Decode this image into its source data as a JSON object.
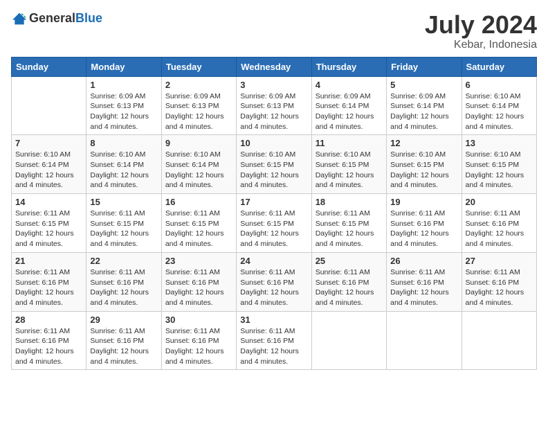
{
  "header": {
    "logo_general": "General",
    "logo_blue": "Blue",
    "month_title": "July 2024",
    "location": "Kebar, Indonesia"
  },
  "days_of_week": [
    "Sunday",
    "Monday",
    "Tuesday",
    "Wednesday",
    "Thursday",
    "Friday",
    "Saturday"
  ],
  "weeks": [
    [
      {
        "day": "",
        "sunrise": "",
        "sunset": "",
        "daylight": ""
      },
      {
        "day": "1",
        "sunrise": "6:09 AM",
        "sunset": "6:13 PM",
        "daylight": "12 hours and 4 minutes."
      },
      {
        "day": "2",
        "sunrise": "6:09 AM",
        "sunset": "6:13 PM",
        "daylight": "12 hours and 4 minutes."
      },
      {
        "day": "3",
        "sunrise": "6:09 AM",
        "sunset": "6:13 PM",
        "daylight": "12 hours and 4 minutes."
      },
      {
        "day": "4",
        "sunrise": "6:09 AM",
        "sunset": "6:14 PM",
        "daylight": "12 hours and 4 minutes."
      },
      {
        "day": "5",
        "sunrise": "6:09 AM",
        "sunset": "6:14 PM",
        "daylight": "12 hours and 4 minutes."
      },
      {
        "day": "6",
        "sunrise": "6:10 AM",
        "sunset": "6:14 PM",
        "daylight": "12 hours and 4 minutes."
      }
    ],
    [
      {
        "day": "7",
        "sunrise": "6:10 AM",
        "sunset": "6:14 PM",
        "daylight": "12 hours and 4 minutes."
      },
      {
        "day": "8",
        "sunrise": "6:10 AM",
        "sunset": "6:14 PM",
        "daylight": "12 hours and 4 minutes."
      },
      {
        "day": "9",
        "sunrise": "6:10 AM",
        "sunset": "6:14 PM",
        "daylight": "12 hours and 4 minutes."
      },
      {
        "day": "10",
        "sunrise": "6:10 AM",
        "sunset": "6:15 PM",
        "daylight": "12 hours and 4 minutes."
      },
      {
        "day": "11",
        "sunrise": "6:10 AM",
        "sunset": "6:15 PM",
        "daylight": "12 hours and 4 minutes."
      },
      {
        "day": "12",
        "sunrise": "6:10 AM",
        "sunset": "6:15 PM",
        "daylight": "12 hours and 4 minutes."
      },
      {
        "day": "13",
        "sunrise": "6:10 AM",
        "sunset": "6:15 PM",
        "daylight": "12 hours and 4 minutes."
      }
    ],
    [
      {
        "day": "14",
        "sunrise": "6:11 AM",
        "sunset": "6:15 PM",
        "daylight": "12 hours and 4 minutes."
      },
      {
        "day": "15",
        "sunrise": "6:11 AM",
        "sunset": "6:15 PM",
        "daylight": "12 hours and 4 minutes."
      },
      {
        "day": "16",
        "sunrise": "6:11 AM",
        "sunset": "6:15 PM",
        "daylight": "12 hours and 4 minutes."
      },
      {
        "day": "17",
        "sunrise": "6:11 AM",
        "sunset": "6:15 PM",
        "daylight": "12 hours and 4 minutes."
      },
      {
        "day": "18",
        "sunrise": "6:11 AM",
        "sunset": "6:15 PM",
        "daylight": "12 hours and 4 minutes."
      },
      {
        "day": "19",
        "sunrise": "6:11 AM",
        "sunset": "6:16 PM",
        "daylight": "12 hours and 4 minutes."
      },
      {
        "day": "20",
        "sunrise": "6:11 AM",
        "sunset": "6:16 PM",
        "daylight": "12 hours and 4 minutes."
      }
    ],
    [
      {
        "day": "21",
        "sunrise": "6:11 AM",
        "sunset": "6:16 PM",
        "daylight": "12 hours and 4 minutes."
      },
      {
        "day": "22",
        "sunrise": "6:11 AM",
        "sunset": "6:16 PM",
        "daylight": "12 hours and 4 minutes."
      },
      {
        "day": "23",
        "sunrise": "6:11 AM",
        "sunset": "6:16 PM",
        "daylight": "12 hours and 4 minutes."
      },
      {
        "day": "24",
        "sunrise": "6:11 AM",
        "sunset": "6:16 PM",
        "daylight": "12 hours and 4 minutes."
      },
      {
        "day": "25",
        "sunrise": "6:11 AM",
        "sunset": "6:16 PM",
        "daylight": "12 hours and 4 minutes."
      },
      {
        "day": "26",
        "sunrise": "6:11 AM",
        "sunset": "6:16 PM",
        "daylight": "12 hours and 4 minutes."
      },
      {
        "day": "27",
        "sunrise": "6:11 AM",
        "sunset": "6:16 PM",
        "daylight": "12 hours and 4 minutes."
      }
    ],
    [
      {
        "day": "28",
        "sunrise": "6:11 AM",
        "sunset": "6:16 PM",
        "daylight": "12 hours and 4 minutes."
      },
      {
        "day": "29",
        "sunrise": "6:11 AM",
        "sunset": "6:16 PM",
        "daylight": "12 hours and 4 minutes."
      },
      {
        "day": "30",
        "sunrise": "6:11 AM",
        "sunset": "6:16 PM",
        "daylight": "12 hours and 4 minutes."
      },
      {
        "day": "31",
        "sunrise": "6:11 AM",
        "sunset": "6:16 PM",
        "daylight": "12 hours and 4 minutes."
      },
      {
        "day": "",
        "sunrise": "",
        "sunset": "",
        "daylight": ""
      },
      {
        "day": "",
        "sunrise": "",
        "sunset": "",
        "daylight": ""
      },
      {
        "day": "",
        "sunrise": "",
        "sunset": "",
        "daylight": ""
      }
    ]
  ]
}
